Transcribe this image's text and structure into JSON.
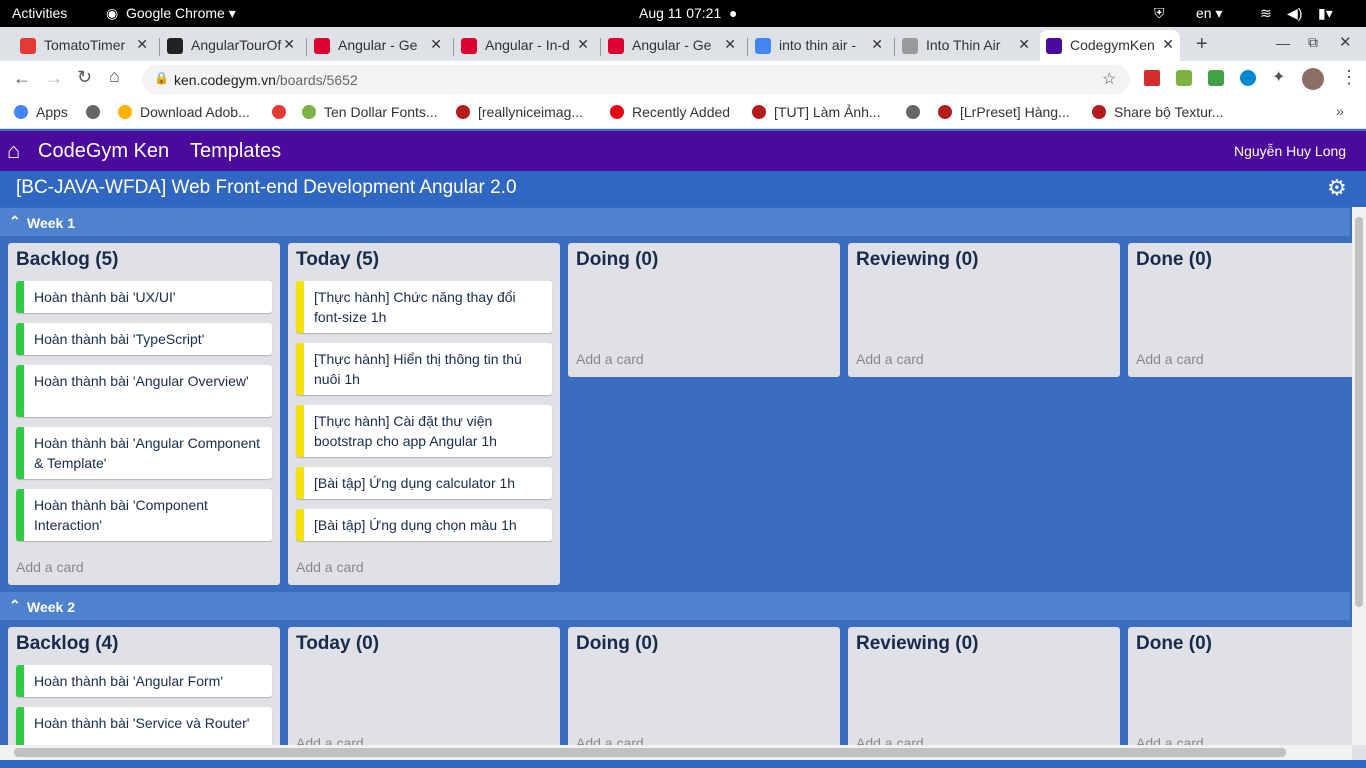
{
  "system": {
    "activities": "Activities",
    "app": "Google Chrome",
    "datetime": "Aug 11  07:21",
    "lang": "en"
  },
  "tabs": [
    {
      "title": "TomatoTimer",
      "icon": "tomato-icon",
      "color": "#e53935"
    },
    {
      "title": "AngularTourOf",
      "icon": "angular-icon",
      "color": "#222"
    },
    {
      "title": "Angular - Ge",
      "icon": "angular-icon",
      "color": "#dd0031"
    },
    {
      "title": "Angular - In-d",
      "icon": "angular-icon",
      "color": "#dd0031"
    },
    {
      "title": "Angular - Ge",
      "icon": "angular-icon",
      "color": "#dd0031"
    },
    {
      "title": "into thin air -",
      "icon": "google-icon",
      "color": "#4285f4"
    },
    {
      "title": "Into Thin Air",
      "icon": "book-icon",
      "color": "#999"
    },
    {
      "title": "CodegymKen",
      "icon": "codegym-icon",
      "color": "#4a0a9b"
    }
  ],
  "url": {
    "host": "ken.codegym.vn",
    "path": "/boards/5652"
  },
  "bookmarks": [
    "Apps",
    "",
    "Download Adob...",
    "",
    "Ten Dollar Fonts...",
    "[reallyniceimag...",
    "Recently Added",
    "[TUT] Làm Ảnh...",
    "",
    "[LrPreset] Hàng...",
    "Share bộ Textur..."
  ],
  "header": {
    "brand": "CodeGym Ken",
    "templates": "Templates",
    "user": "Nguyễn Huy Long"
  },
  "board": {
    "title": "[BC-JAVA-WFDA] Web Front-end Development Angular 2.0"
  },
  "weeks": [
    {
      "label": "Week 1",
      "lists": [
        {
          "title": "Backlog (5)",
          "cards": [
            "Hoàn thành bài 'UX/UI'",
            "Hoàn thành bài 'TypeScript'",
            "Hoàn thành bài 'Angular Overview'",
            "Hoàn thành bài 'Angular Component & Template'",
            "Hoàn thành bài 'Component Interaction'"
          ]
        },
        {
          "title": "Today (5)",
          "cards": [
            "[Thực hành] Chức năng thay đổi font-size 1h",
            "[Thực hành] Hiển thị thông tin thú nuôi 1h",
            "[Thực hành] Cài đặt thư viện bootstrap cho app Angular 1h",
            "[Bài tập] Ứng dụng calculator 1h",
            "[Bài tập] Ứng dụng chọn màu 1h"
          ]
        },
        {
          "title": "Doing (0)",
          "cards": []
        },
        {
          "title": "Reviewing (0)",
          "cards": []
        },
        {
          "title": "Done (0)",
          "cards": []
        }
      ]
    },
    {
      "label": "Week 2",
      "lists": [
        {
          "title": "Backlog (4)",
          "cards": [
            "Hoàn thành bài 'Angular Form'",
            "Hoàn thành bài 'Service và Router'"
          ]
        },
        {
          "title": "Today (0)",
          "cards": []
        },
        {
          "title": "Doing (0)",
          "cards": []
        },
        {
          "title": "Reviewing (0)",
          "cards": []
        },
        {
          "title": "Done (0)",
          "cards": []
        }
      ]
    }
  ],
  "add_card_label": "Add a card",
  "colors": {
    "header": "#4a0a9b",
    "board": "#3b6dbe",
    "backlog_label": "#2ecc40",
    "today_label": "#f5e20d"
  }
}
